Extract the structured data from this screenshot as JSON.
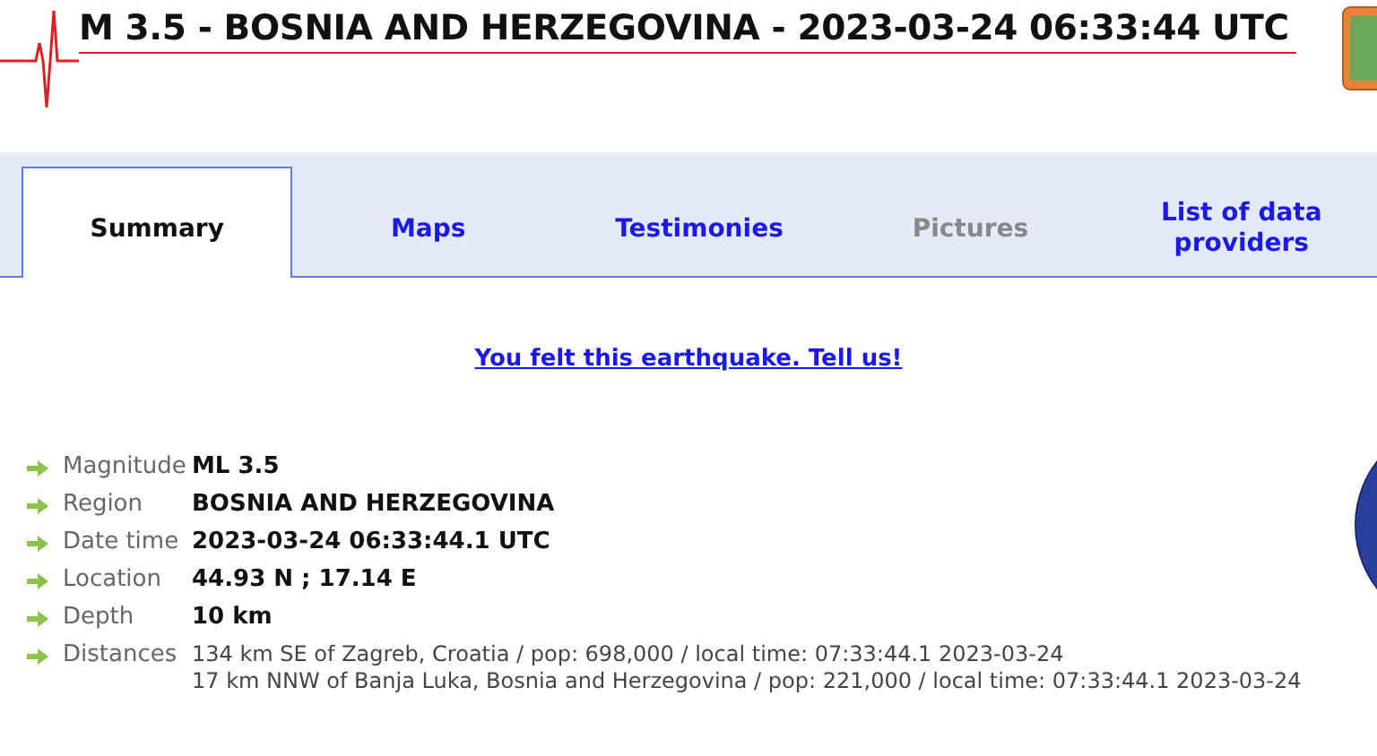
{
  "header": {
    "title": "M 3.5 - BOSNIA AND HERZEGOVINA - 2023-03-24 06:33:44 UTC"
  },
  "tabs": [
    {
      "label": "Summary",
      "selected": true,
      "disabled": false
    },
    {
      "label": "Maps",
      "selected": false,
      "disabled": false
    },
    {
      "label": "Testimonies",
      "selected": false,
      "disabled": false
    },
    {
      "label": "Pictures",
      "selected": false,
      "disabled": true
    },
    {
      "label": "List of data providers",
      "selected": false,
      "disabled": false
    }
  ],
  "felt_link": "You felt this earthquake. Tell us!",
  "details": [
    {
      "label": "Magnitude",
      "values": [
        "ML 3.5"
      ],
      "bold": true
    },
    {
      "label": "Region",
      "values": [
        "BOSNIA AND HERZEGOVINA"
      ],
      "bold": true
    },
    {
      "label": "Date time",
      "values": [
        "2023-03-24 06:33:44.1 UTC"
      ],
      "bold": true
    },
    {
      "label": "Location",
      "values": [
        "44.93 N ; 17.14 E"
      ],
      "bold": true
    },
    {
      "label": "Depth",
      "values": [
        "10 km"
      ],
      "bold": true
    },
    {
      "label": "Distances",
      "values": [
        "134 km SE of Zagreb, Croatia / pop: 698,000 / local time: 07:33:44.1 2023-03-24",
        "17 km NNW of Banja Luka, Bosnia and Herzegovina / pop: 221,000 / local time: 07:33:44.1 2023-03-24"
      ],
      "bold": false
    }
  ]
}
